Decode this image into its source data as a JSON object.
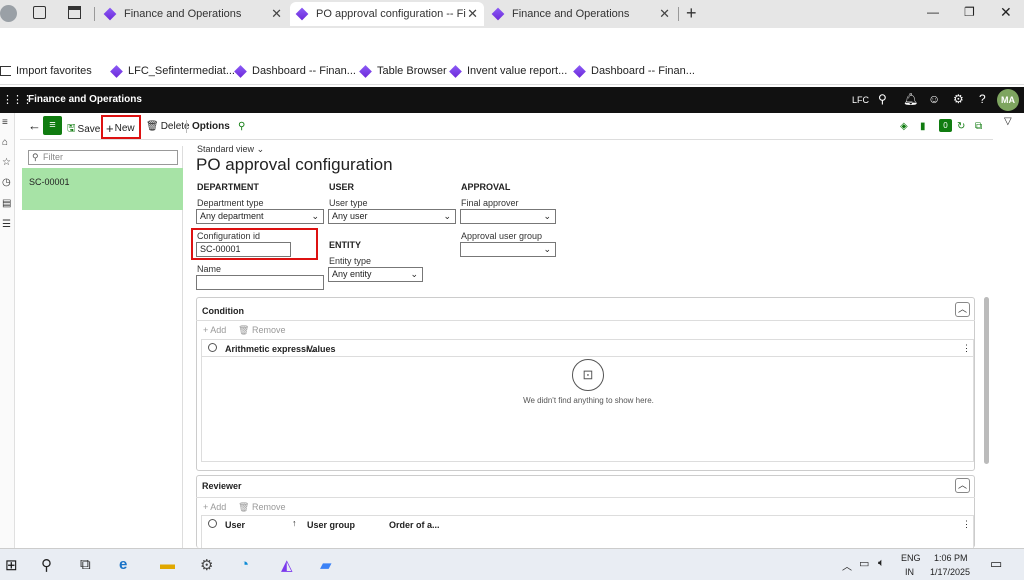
{
  "browser": {
    "tabs": [
      {
        "label": "Finance and Operations"
      },
      {
        "label": "PO approval configuration -- Fina"
      },
      {
        "label": "Finance and Operations"
      }
    ],
    "favorites": [
      {
        "label": "Import favorites"
      },
      {
        "label": "LFC_Sefintermediat..."
      },
      {
        "label": "Dashboard -- Finan..."
      },
      {
        "label": "Table Browser"
      },
      {
        "label": "Invent value report..."
      },
      {
        "label": "Dashboard -- Finan..."
      }
    ]
  },
  "app": {
    "title": "Finance and Operations",
    "company": "LFC",
    "avatar": "MA"
  },
  "actions": {
    "save": "Save",
    "new": "New",
    "delete": "Delete",
    "options": "Options",
    "badge": "0"
  },
  "list": {
    "filter_placeholder": "Filter",
    "items": [
      "SC-00001"
    ]
  },
  "form": {
    "view": "Standard view",
    "title": "PO approval configuration",
    "department_header": "DEPARTMENT",
    "department_type_label": "Department type",
    "department_type_value": "Any department",
    "configuration_id_label": "Configuration id",
    "configuration_id_value": "SC-00001",
    "name_label": "Name",
    "name_value": "",
    "user_header": "USER",
    "user_type_label": "User type",
    "user_type_value": "Any user",
    "entity_header": "ENTITY",
    "entity_type_label": "Entity type",
    "entity_type_value": "Any entity",
    "approval_header": "APPROVAL",
    "final_approver_label": "Final approver",
    "final_approver_value": "",
    "approval_user_group_label": "Approval user group",
    "approval_user_group_value": ""
  },
  "condition": {
    "title": "Condition",
    "add": "Add",
    "remove": "Remove",
    "columns": [
      "Arithmetic expressi...",
      "Values"
    ],
    "empty": "We didn't find anything to show here."
  },
  "reviewer": {
    "title": "Reviewer",
    "add": "Add",
    "remove": "Remove",
    "columns": [
      "User",
      "User group",
      "Order of a..."
    ]
  },
  "taskbar": {
    "lang1": "ENG",
    "lang2": "IN",
    "time": "1:06 PM",
    "date": "1/17/2025"
  }
}
